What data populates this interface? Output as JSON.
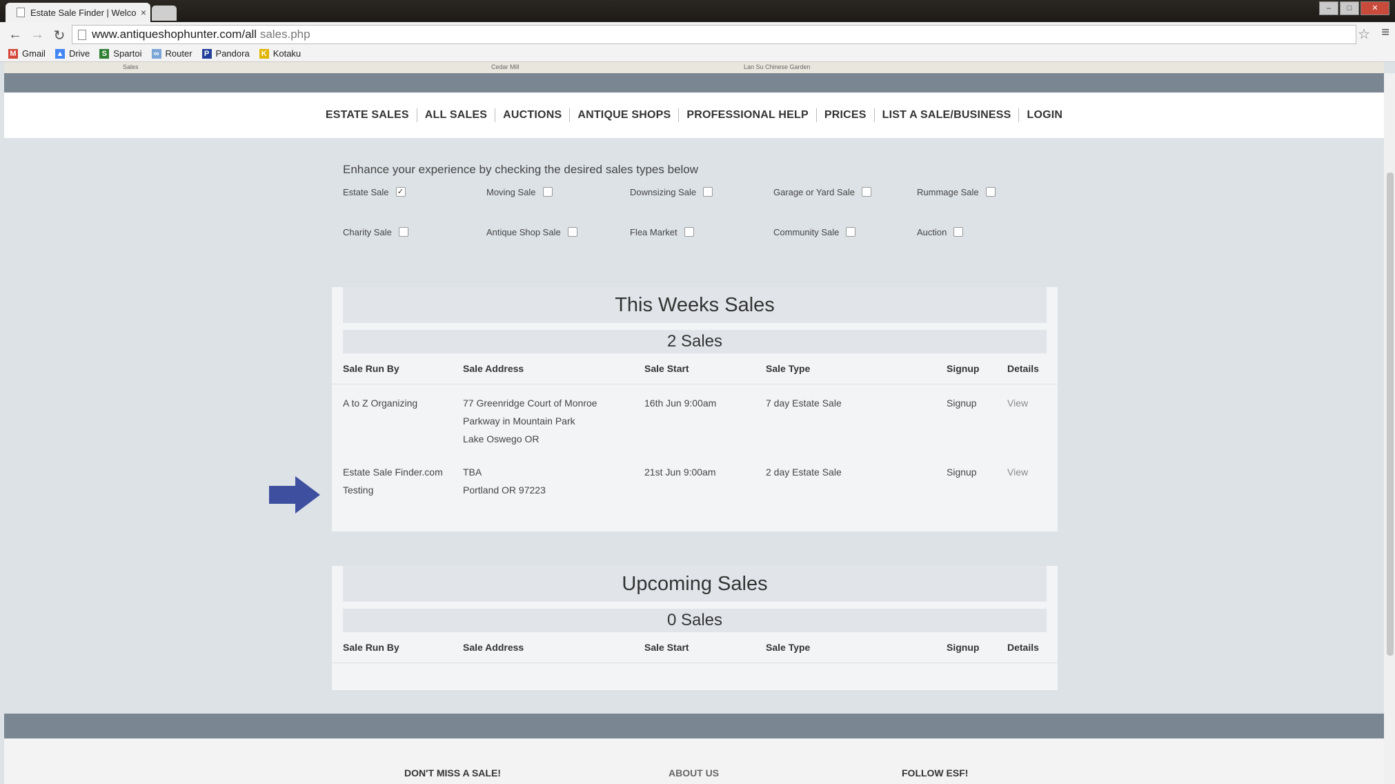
{
  "browser": {
    "tab_title": "Estate Sale Finder | Welcor",
    "tab_close": "×",
    "url_host": "www.antiqueshophunter.com/all",
    "url_rest": " sales.php",
    "bookmarks": [
      {
        "label": "Gmail",
        "icon": "gmail-icon",
        "color": "#d44638"
      },
      {
        "label": "Drive",
        "icon": "drive-icon",
        "color": "#4285f4"
      },
      {
        "label": "Spartoi",
        "icon": "spartoi-icon",
        "color": "#2e7d32"
      },
      {
        "label": "Router",
        "icon": "router-icon",
        "color": "#7aa6d6"
      },
      {
        "label": "Pandora",
        "icon": "pandora-icon",
        "color": "#224099"
      },
      {
        "label": "Kotaku",
        "icon": "kotaku-icon",
        "color": "#e0b400"
      }
    ]
  },
  "map": {
    "labels": [
      "Sales",
      "Cedar Mill",
      "Lan Su Chinese Garden"
    ]
  },
  "nav": {
    "items": [
      "ESTATE SALES",
      "ALL SALES",
      "AUCTIONS",
      "ANTIQUE SHOPS",
      "PROFESSIONAL HELP",
      "PRICES",
      "LIST A SALE/BUSINESS",
      "LOGIN"
    ]
  },
  "sale_types": {
    "intro": "Enhance your experience by checking the desired sales types below",
    "options": [
      {
        "label": "Estate Sale",
        "checked": true
      },
      {
        "label": "Moving Sale",
        "checked": false
      },
      {
        "label": "Downsizing Sale",
        "checked": false
      },
      {
        "label": "Garage or Yard Sale",
        "checked": false
      },
      {
        "label": "Rummage Sale",
        "checked": false
      },
      {
        "label": "Charity Sale",
        "checked": false
      },
      {
        "label": "Antique Shop Sale",
        "checked": false
      },
      {
        "label": "Flea Market",
        "checked": false
      },
      {
        "label": "Community Sale",
        "checked": false
      },
      {
        "label": "Auction",
        "checked": false
      }
    ]
  },
  "this_week": {
    "title": "This Weeks Sales",
    "count": "2 Sales",
    "columns": [
      "Sale Run By",
      "Sale Address",
      "Sale Start",
      "Sale Type",
      "Signup",
      "Details"
    ],
    "rows": [
      {
        "run_by": "A to Z Organizing",
        "address": [
          "77 Greenridge Court of Monroe",
          "Parkway in Mountain Park",
          "Lake Oswego OR"
        ],
        "start": "16th Jun 9:00am",
        "type": "7 day Estate Sale",
        "signup": "Signup",
        "details": "View"
      },
      {
        "run_by": "Estate Sale Finder.com Testing",
        "address": [
          "TBA",
          "Portland OR 97223"
        ],
        "start": "21st Jun 9:00am",
        "type": "2 day Estate Sale",
        "signup": "Signup",
        "details": "View"
      }
    ]
  },
  "upcoming": {
    "title": "Upcoming Sales",
    "count": "0 Sales",
    "columns": [
      "Sale Run By",
      "Sale Address",
      "Sale Start",
      "Sale Type",
      "Signup",
      "Details"
    ]
  },
  "footer": {
    "col1": "DON'T MISS A SALE!",
    "col2": "ABOUT US",
    "col3": "FOLLOW ESF!"
  },
  "colors": {
    "bar": "#7a8691",
    "arrow": "#3f4fa0"
  }
}
